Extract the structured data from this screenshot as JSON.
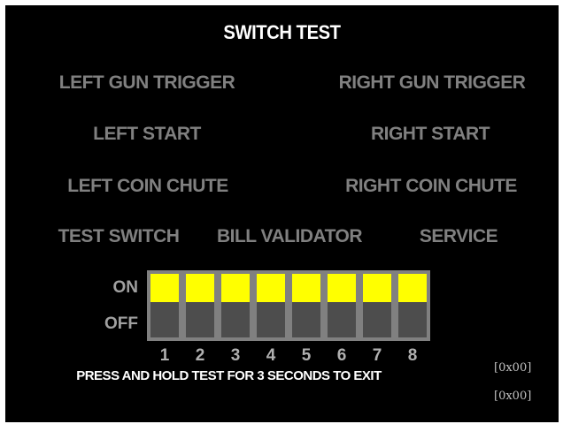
{
  "screen": {
    "title": "SWITCH TEST",
    "switches": {
      "left_gun_trigger": "LEFT GUN TRIGGER",
      "right_gun_trigger": "RIGHT GUN TRIGGER",
      "left_start": "LEFT START",
      "right_start": "RIGHT START",
      "left_coin_chute": "LEFT COIN CHUTE",
      "right_coin_chute": "RIGHT COIN CHUTE",
      "test_switch": "TEST SWITCH",
      "bill_validator": "BILL VALIDATOR",
      "service": "SERVICE"
    },
    "dip": {
      "on_label": "ON",
      "off_label": "OFF",
      "numbers": [
        "1",
        "2",
        "3",
        "4",
        "5",
        "6",
        "7",
        "8"
      ],
      "states": [
        "ON",
        "ON",
        "ON",
        "ON",
        "ON",
        "ON",
        "ON",
        "ON"
      ]
    },
    "exit_message": "PRESS AND HOLD TEST FOR 3 SECONDS TO EXIT",
    "hex_values": [
      "[0x00]",
      "[0x00]"
    ]
  },
  "colors": {
    "background": "#000000",
    "inactive_label": "#808080",
    "dip_on": "#ffff00",
    "dip_slot": "#4d4d4d",
    "dip_frame": "#808080"
  }
}
